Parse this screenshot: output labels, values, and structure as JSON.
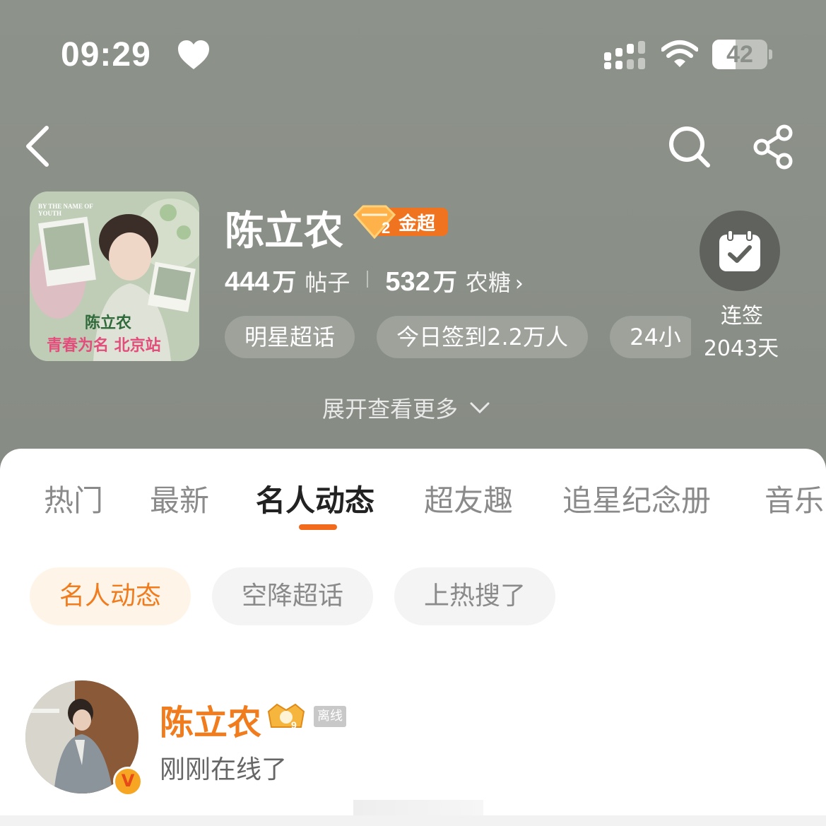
{
  "status_bar": {
    "time": "09:29",
    "battery": "42",
    "battery_level": 0.42
  },
  "topic": {
    "title": "陈立农",
    "rank_label": "金超",
    "rank_level": "2",
    "cover": {
      "english": "BY THE NAME OF YOUTH",
      "caption_name": "陈立农",
      "caption_event": "青春为名 北京站"
    },
    "stats": {
      "posts_num": "444",
      "posts_unit": "万",
      "posts_label": "帖子",
      "sugar_num": "532",
      "sugar_unit": "万",
      "sugar_label": "农糖",
      "sugar_chevron": "›"
    },
    "tags": [
      "明星超话",
      "今日签到2.2万人",
      "24小"
    ],
    "checkin": {
      "label": "连签",
      "days": "2043天"
    },
    "expand_label": "展开查看更多"
  },
  "tabs": [
    {
      "label": "热门"
    },
    {
      "label": "最新"
    },
    {
      "label": "名人动态",
      "active": true
    },
    {
      "label": "超友趣"
    },
    {
      "label": "追星纪念册"
    },
    {
      "label": "音乐"
    }
  ],
  "chips": [
    {
      "label": "名人动态",
      "active": true
    },
    {
      "label": "空降超话"
    },
    {
      "label": "上热搜了"
    }
  ],
  "post": {
    "user_name": "陈立农",
    "offline_label": "离线",
    "verified_mark": "V",
    "crown_level": "9",
    "status": "刚刚在线了"
  },
  "colors": {
    "accent": "#f07c1e",
    "header_bg": "#8b908a",
    "tab_underline": "#f26a1b"
  }
}
